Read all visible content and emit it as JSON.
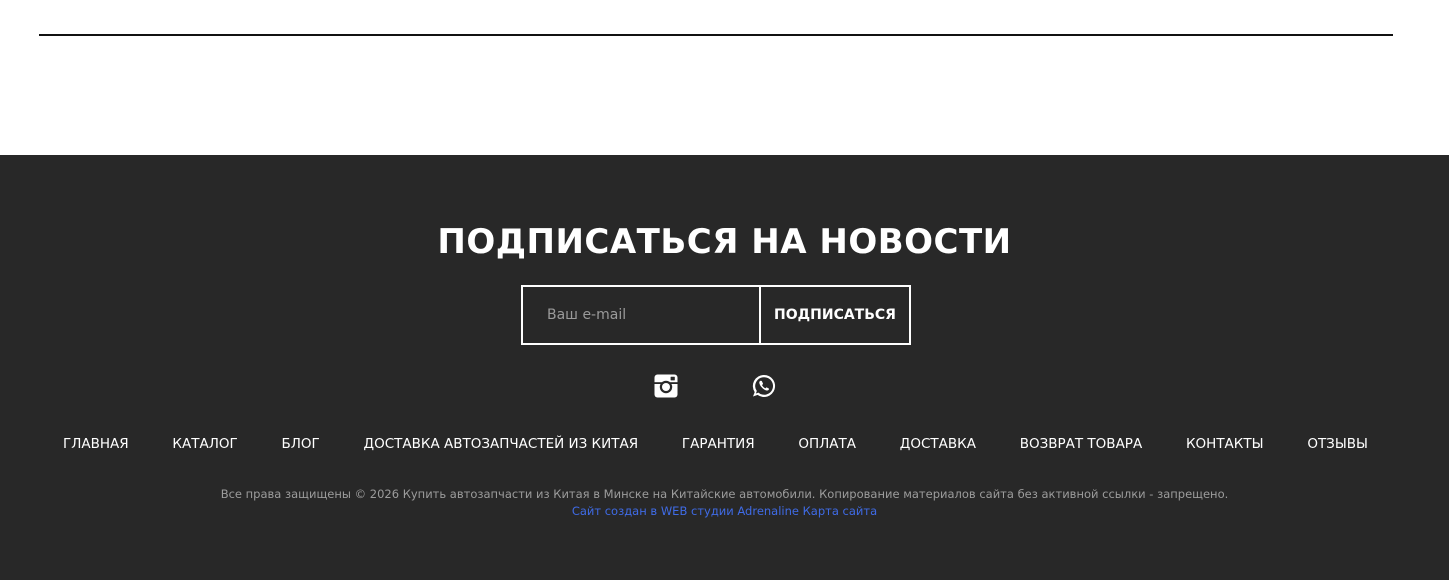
{
  "subscribe": {
    "title": "ПОДПИСАТЬСЯ НА НОВОСТИ",
    "email_placeholder": "Ваш e-mail",
    "button_label": "ПОДПИСАТЬСЯ"
  },
  "social": [
    {
      "name": "instagram-icon"
    },
    {
      "name": "whatsapp-icon"
    }
  ],
  "nav": {
    "items": [
      {
        "label": "ГЛАВНАЯ"
      },
      {
        "label": "КАТАЛОГ"
      },
      {
        "label": "БЛОГ"
      },
      {
        "label": "ДОСТАВКА АВТОЗАПЧАСТЕЙ ИЗ КИТАЯ"
      },
      {
        "label": "ГАРАНТИЯ"
      },
      {
        "label": "ОПЛАТА"
      },
      {
        "label": "ДОСТАВКА"
      },
      {
        "label": "ВОЗВРАТ ТОВАРА"
      },
      {
        "label": "КОНТАКТЫ"
      },
      {
        "label": "ОТЗЫВЫ"
      }
    ]
  },
  "footer": {
    "copyright": "Все права защищены © 2026 Купить автозапчасти из Китая в Минске на Китайские автомобили. Копирование материалов сайта без активной ссылки - запрещено.",
    "studio_link": "Сайт создан в WEB студии Adrenaline",
    "sitemap_link": "Карта сайта"
  },
  "colors": {
    "footer_bg": "#282828",
    "link_blue": "#3f6be6",
    "muted_text": "#9c9c9c"
  }
}
